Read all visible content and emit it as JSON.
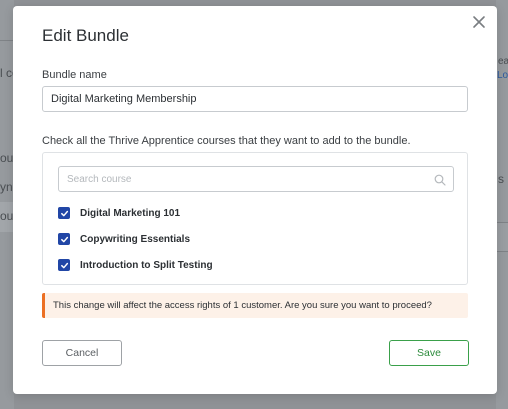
{
  "background": {
    "fragments": [
      "l co",
      "our",
      "ynar",
      "our",
      "ea",
      "Lo",
      "s"
    ]
  },
  "modal": {
    "title": "Edit Bundle",
    "close_icon": "close-icon",
    "bundle_name_label": "Bundle name",
    "bundle_name_value": "Digital Marketing Membership",
    "courses_instruction": "Check all the Thrive Apprentice courses that they want to add to the bundle.",
    "search": {
      "placeholder": "Search course",
      "icon": "search-icon"
    },
    "courses": [
      {
        "label": "Digital Marketing 101",
        "checked": true
      },
      {
        "label": "Copywriting Essentials",
        "checked": true
      },
      {
        "label": "Introduction to Split Testing",
        "checked": true
      }
    ],
    "warning": "This change will affect the access rights of 1 customer. Are you sure you want to proceed?",
    "cancel_label": "Cancel",
    "save_label": "Save"
  },
  "colors": {
    "checkbox": "#2146a6",
    "warning_accent": "#ec7024",
    "warning_bg": "#fdf1e8",
    "save": "#3aa04a"
  }
}
